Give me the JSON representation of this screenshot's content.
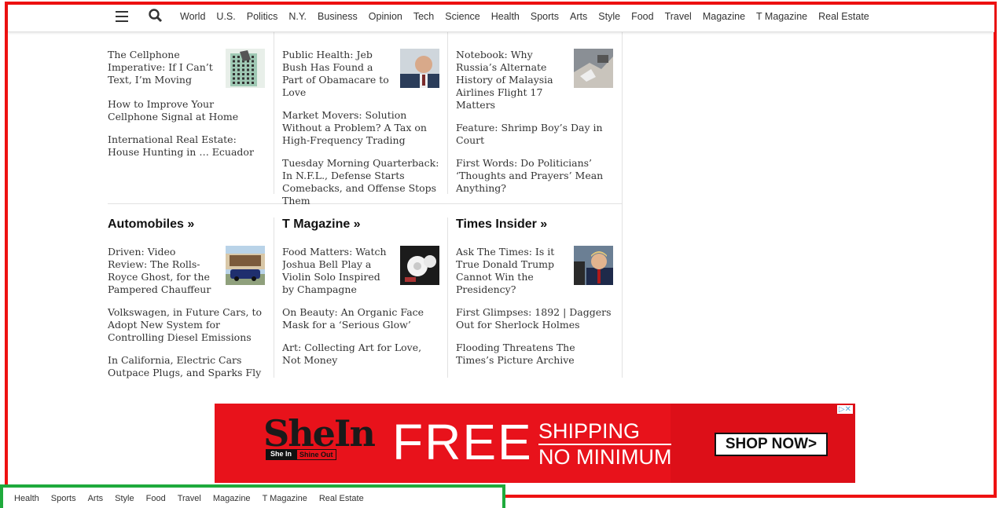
{
  "nav": {
    "items": [
      "World",
      "U.S.",
      "Politics",
      "N.Y.",
      "Business",
      "Opinion",
      "Tech",
      "Science",
      "Health",
      "Sports",
      "Arts",
      "Style",
      "Food",
      "Travel",
      "Magazine",
      "T Magazine",
      "Real Estate"
    ]
  },
  "bottom_nav": {
    "items": [
      "Health",
      "Sports",
      "Arts",
      "Style",
      "Food",
      "Travel",
      "Magazine",
      "T Magazine",
      "Real Estate"
    ]
  },
  "sections_top": [
    {
      "lead": "The Cellphone Imperative: If I Can’t Text, I’m Moving",
      "lead_icon": "building-thumbnail",
      "stories": [
        "How to Improve Your Cellphone Signal at Home",
        "International Real Estate: House Hunting in … Ecuador"
      ]
    },
    {
      "lead": "Public Health: Jeb Bush Has Found a Part of Obamacare to Love",
      "lead_icon": "portrait-thumbnail",
      "stories": [
        "Market Movers: Solution Without a Problem? A Tax on High-Frequency Trading",
        "Tuesday Morning Quarterback: In N.F.L., Defense Starts Comebacks, and Offense Stops Them"
      ]
    },
    {
      "lead": "Notebook: Why Russia’s Alternate History of Malaysia Airlines Flight 17 Matters",
      "lead_icon": "wreckage-thumbnail",
      "stories": [
        "Feature: Shrimp Boy’s Day in Court",
        "First Words: Do Politicians’ ‘Thoughts and Prayers’ Mean Anything?"
      ]
    }
  ],
  "sections_bottom": [
    {
      "heading": "Automobiles »",
      "lead": "Driven: Video Review: The Rolls-Royce Ghost, for the Pampered Chauffeur",
      "lead_icon": "car-thumbnail",
      "stories": [
        "Volkswagen, in Future Cars, to Adopt New System for Controlling Diesel Emissions",
        "In California, Electric Cars Outpace Plugs, and Sparks Fly"
      ]
    },
    {
      "heading": "T Magazine »",
      "lead": "Food Matters: Watch Joshua Bell Play a Violin Solo Inspired by Champagne",
      "lead_icon": "food-thumbnail",
      "stories": [
        "On Beauty: An Organic Face Mask for a ‘Serious Glow’",
        "Art: Collecting Art for Love, Not Money"
      ]
    },
    {
      "heading": "Times Insider »",
      "lead": "Ask The Times: Is it True Donald Trump Cannot Win the Presidency?",
      "lead_icon": "trump-thumbnail",
      "stories": [
        "First Glimpses: 1892 | Daggers Out for Sherlock Holmes",
        "Flooding Threatens The Times’s Picture Archive"
      ]
    }
  ],
  "ad": {
    "brand": "SheIn",
    "tag_left": "She In",
    "tag_right": "Shine Out",
    "free": "FREE",
    "shipping": "SHIPPING",
    "no_minimum": "NO MINIMUM",
    "cta": "SHOP NOW>",
    "adchoices": "▷✕"
  },
  "colors": {
    "ad_red": "#e8121b",
    "frame_red": "#ee1111",
    "frame_green": "#1faa3c"
  }
}
